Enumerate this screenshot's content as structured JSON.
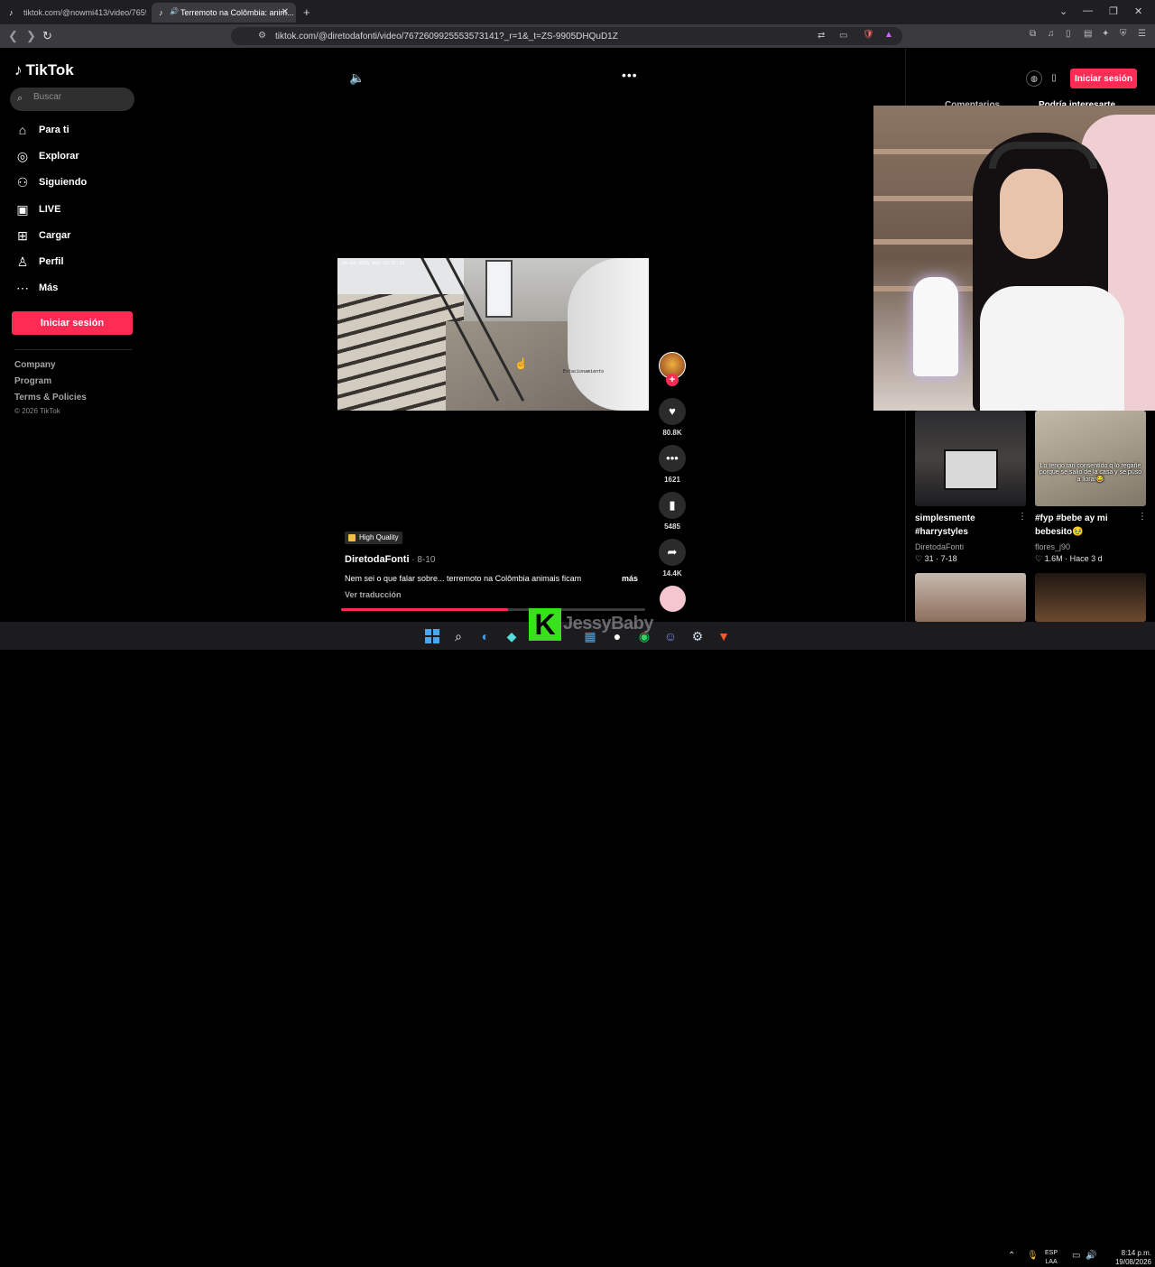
{
  "browser": {
    "tabs": [
      {
        "title": "tiktok.com/@nowmi413/video/7659...",
        "favicon": "tiktok-icon",
        "active": false
      },
      {
        "title": "Terremoto na Colômbia: anim...",
        "favicon": "tiktok-icon",
        "active": true,
        "muted_indicator": "speaker-icon"
      }
    ],
    "new_tab": "+",
    "address": "tiktok.com/@diretodafonti/video/7672609925553573141?_r=1&_t=ZS-9905DHQuD1Z"
  },
  "sidebar": {
    "logo": "TikTok",
    "search_placeholder": "Buscar",
    "nav": [
      {
        "label": "Para ti",
        "icon": "home-icon"
      },
      {
        "label": "Explorar",
        "icon": "compass-icon"
      },
      {
        "label": "Siguiendo",
        "icon": "following-icon"
      },
      {
        "label": "LIVE",
        "icon": "live-icon"
      },
      {
        "label": "Cargar",
        "icon": "upload-icon"
      },
      {
        "label": "Perfil",
        "icon": "profile-icon"
      },
      {
        "label": "Más",
        "icon": "more-icon"
      }
    ],
    "login_label": "Iniciar sesión",
    "footer": [
      "Company",
      "Program",
      "Terms & Policies"
    ],
    "copyright": "© 2026 TikTok"
  },
  "video": {
    "timestamp_overlay": "06-24-2026 Wed 16:35:33",
    "caption_overlay": "Estacionamiento",
    "badge": "High Quality",
    "author": "DiretodaFonti",
    "date": " · 8-10",
    "description": "Nem sei o que falar sobre...  terremoto na Colômbia animais ficam",
    "more": "más",
    "translate": "Ver traducción",
    "progress_fraction": 0.55
  },
  "actions": {
    "likes": "80.8K",
    "comments": "1621",
    "saves": "5485",
    "shares": "14.4K"
  },
  "right_panel": {
    "login_label": "Iniciar sesión",
    "tabs": [
      "Comentarios",
      "Podría interesarte"
    ],
    "recommendations": [
      {
        "title": "simplesmente #harrystyles",
        "author": "DiretodaFonti",
        "stats": "♡ 31  · 7-18"
      },
      {
        "title": "#fyp #bebe ay mi bebesito🥹",
        "author": "flores_j90",
        "stats": "♡ 1.6M  · Hace 3 d",
        "thumb_text": "Lo tengo tan consentido q lo regañe porque se salio de la casa y se puso a llorar😂"
      }
    ]
  },
  "overlay": {
    "streamer_logo": "K",
    "streamer_name": "JessyBaby"
  },
  "taskbar": {
    "lang": "ESP",
    "lang_sub": "LAA",
    "time": "8:14 p.m.",
    "date": "19/08/2026"
  },
  "colors": {
    "accent": "#fe2c55",
    "background": "#000000",
    "sidebar_search": "#2f2f2f"
  }
}
